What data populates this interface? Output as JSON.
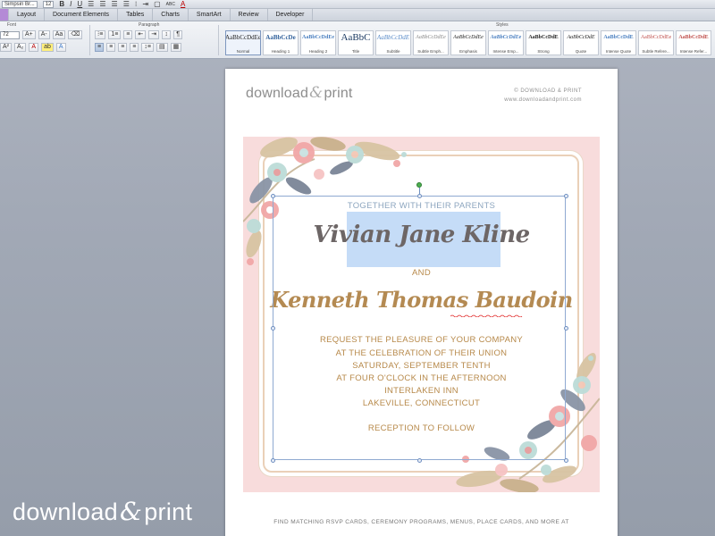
{
  "toolbar": {
    "font_name": "Simpsin Br...",
    "font_size": "12",
    "bold": "B",
    "italic": "I",
    "underline": "U",
    "abc": "ABC",
    "font_color": "A"
  },
  "ribbon": {
    "tabs": [
      {
        "label": ""
      },
      {
        "label": "Layout"
      },
      {
        "label": "Document Elements"
      },
      {
        "label": "Tables"
      },
      {
        "label": "Charts"
      },
      {
        "label": "SmartArt"
      },
      {
        "label": "Review"
      },
      {
        "label": "Developer"
      }
    ],
    "groups": {
      "font": "Font",
      "paragraph": "Paragraph",
      "styles": "Styles"
    },
    "font_size_field": "72",
    "styles": [
      {
        "sample": "AaBbCcDdEe",
        "name": "Normal"
      },
      {
        "sample": "AaBbCcDe",
        "name": "Heading 1"
      },
      {
        "sample": "AaBbCcDdEe",
        "name": "Heading 2"
      },
      {
        "sample": "AaBbC",
        "name": "Title"
      },
      {
        "sample": "AaBbCcDdE",
        "name": "Subtitle"
      },
      {
        "sample": "AaBbCcDdEe",
        "name": "Subtle Emph..."
      },
      {
        "sample": "AaBbCcDdEe",
        "name": "Emphasis"
      },
      {
        "sample": "AaBbCcDdEe",
        "name": "Intense Emp..."
      },
      {
        "sample": "AaBbCcDdE",
        "name": "Strong"
      },
      {
        "sample": "AaBbCcDdE",
        "name": "Quote"
      },
      {
        "sample": "AaBbCcDdE",
        "name": "Intense Quote"
      },
      {
        "sample": "AaBbCcDdEe",
        "name": "Subtle Refere..."
      },
      {
        "sample": "AaBbCcDdE",
        "name": "Intense Refer..."
      }
    ]
  },
  "page": {
    "brand_left": "download",
    "brand_amp": "&",
    "brand_right": "print",
    "copyright": "© DOWNLOAD & PRINT",
    "website": "www.downloadandprint.com",
    "footer_note": "FIND MATCHING RSVP CARDS, CEREMONY PROGRAMS, MENUS, PLACE CARDS, AND MORE AT"
  },
  "invitation": {
    "together": "TOGETHER WITH THEIR PARENTS",
    "bride": "Vivian Jane Kline",
    "and": "AND",
    "groom": "Kenneth Thomas Baudoin",
    "request_lines": [
      "REQUEST THE PLEASURE OF YOUR COMPANY",
      "AT THE CELEBRATION OF THEIR UNION",
      "SATURDAY, SEPTEMBER TENTH",
      "AT FOUR O'CLOCK IN THE AFTERNOON",
      "INTERLAKEN INN",
      "LAKEVILLE, CONNECTICUT"
    ],
    "reception": "RECEPTION TO FOLLOW"
  },
  "watermark": {
    "left": "download",
    "amp": "&",
    "right": "print"
  },
  "colors": {
    "pink_background": "#f8dcdc",
    "gold_text": "#b7894a",
    "blue_text": "#8da6bf",
    "bride_text": "#6d6666",
    "selection_highlight": "#c5dcf7",
    "ribbon_lead_tab": "#b48ad6"
  }
}
